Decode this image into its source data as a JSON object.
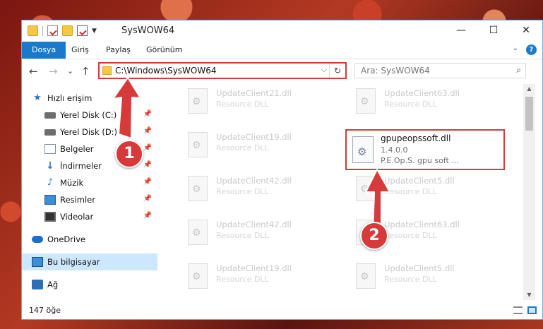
{
  "window": {
    "title": "SysWOW64",
    "buttons": {
      "minimize": "—",
      "maximize": "☐",
      "close": "✕"
    }
  },
  "ribbon": {
    "tabs": [
      "Dosya",
      "Giriş",
      "Paylaş",
      "Görünüm"
    ],
    "help": "?"
  },
  "address": {
    "path": "C:\\Windows\\SysWOW64",
    "dropdown": "⌵",
    "refresh": "↻"
  },
  "nav_buttons": {
    "back": "←",
    "forward": "→",
    "recent": "⌄",
    "up": "↑"
  },
  "search": {
    "placeholder": "Ara: SysWOW64",
    "icon": "⌕"
  },
  "sidebar": {
    "items": [
      {
        "label": "Hızlı erişim",
        "icon": "quick-access-icon",
        "glyph": "★"
      },
      {
        "label": "Yerel Disk (C:)",
        "icon": "drive-icon",
        "glyph": ""
      },
      {
        "label": "Yerel Disk (D:)",
        "icon": "drive-icon",
        "glyph": ""
      },
      {
        "label": "Belgeler",
        "icon": "documents-icon",
        "glyph": ""
      },
      {
        "label": "İndirmeler",
        "icon": "downloads-icon",
        "glyph": "↓"
      },
      {
        "label": "Müzik",
        "icon": "music-icon",
        "glyph": "♪"
      },
      {
        "label": "Resimler",
        "icon": "pictures-icon",
        "glyph": ""
      },
      {
        "label": "Videolar",
        "icon": "videos-icon",
        "glyph": ""
      },
      {
        "label": "OneDrive",
        "icon": "onedrive-icon",
        "glyph": ""
      },
      {
        "label": "Bu bilgisayar",
        "icon": "this-pc-icon",
        "glyph": ""
      },
      {
        "label": "Ağ",
        "icon": "network-icon",
        "glyph": ""
      }
    ],
    "pin": "📌"
  },
  "files": [
    {
      "name": "UpdateClient21.dll",
      "desc": "Resource DLL"
    },
    {
      "name": "UpdateClient63.dll",
      "desc": "Resource DLL"
    },
    {
      "name": "UpdateClient19.dll",
      "desc": "Resource DLL"
    },
    {
      "name": "UpdateClient42.dll",
      "desc": "Resource DLL"
    },
    {
      "name": "UpdateClient5.dll",
      "desc": "Resource DLL"
    },
    {
      "name": "UpdateClient42.dll",
      "desc": "Resource DLL"
    },
    {
      "name": "UpdateClient63.dll",
      "desc": "Resource DLL"
    },
    {
      "name": "UpdateClient19.dll",
      "desc": "Resource DLL"
    },
    {
      "name": "UpdateClient5.dll",
      "desc": "Resource DLL"
    }
  ],
  "highlighted_file": {
    "name": "gpupeopssoft.dll",
    "version": "1.4.0.0",
    "desc": "P.E.Op.S. gpu soft ..."
  },
  "status": {
    "count": "147 öğe"
  },
  "annotations": {
    "marker1": "1",
    "marker2": "2",
    "color": "#d63a3a"
  },
  "colors": {
    "accent": "#1979ca",
    "highlight": "#d63a3a",
    "selection": "#cce8ff"
  }
}
